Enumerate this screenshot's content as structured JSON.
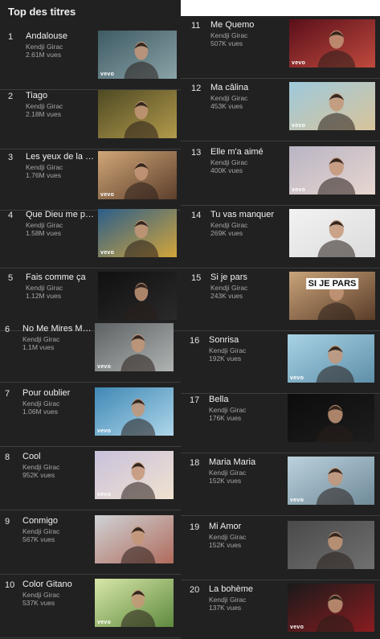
{
  "heading": "Top des titres",
  "tracks": [
    {
      "rank": "1",
      "title": "Andalouse",
      "artist": "Kendji Girac",
      "views": "2.61M vues",
      "badge": "vevo",
      "caption": "",
      "bg": [
        "#3e5a63",
        "#8aa3a8"
      ]
    },
    {
      "rank": "2",
      "title": "Tiago",
      "artist": "Kendji Girac",
      "views": "2.18M vues",
      "badge": "",
      "caption": "",
      "bg": [
        "#4f4a24",
        "#b29a4b"
      ]
    },
    {
      "rank": "3",
      "title": "Les yeux de la ma...",
      "artist": "Kendji Girac",
      "views": "1.76M vues",
      "badge": "vevo",
      "caption": "",
      "bg": [
        "#d1a778",
        "#5c3e2b"
      ]
    },
    {
      "rank": "4",
      "title": "Que Dieu me pardo...",
      "artist": "Kendji Girac",
      "views": "1.58M vues",
      "badge": "vevo",
      "caption": "",
      "bg": [
        "#2b5e8a",
        "#d3a53a"
      ]
    },
    {
      "rank": "5",
      "title": "Fais comme ça",
      "artist": "Kendji Girac",
      "views": "1.12M vues",
      "badge": "",
      "caption": "",
      "bg": [
        "#101010",
        "#2a2a2a"
      ]
    },
    {
      "rank": "6",
      "title": "No Me Mires Más (...",
      "artist": "Kendji Girac",
      "views": "1.1M vues",
      "badge": "vevo",
      "caption": "",
      "bg": [
        "#5d6264",
        "#b0b3b2"
      ]
    },
    {
      "rank": "7",
      "title": "Pour oublier",
      "artist": "Kendji Girac",
      "views": "1.06M vues",
      "badge": "vevo",
      "caption": "",
      "bg": [
        "#3f88b5",
        "#aed6ea"
      ]
    },
    {
      "rank": "8",
      "title": "Cool",
      "artist": "Kendji Girac",
      "views": "952K vues",
      "badge": "vevo",
      "caption": "",
      "bg": [
        "#c9c1dc",
        "#f0e2cf"
      ]
    },
    {
      "rank": "9",
      "title": "Conmigo",
      "artist": "Kendji Girac",
      "views": "567K vues",
      "badge": "",
      "caption": "",
      "bg": [
        "#cfd3d6",
        "#b06b5c"
      ]
    },
    {
      "rank": "10",
      "title": "Color Gitano",
      "artist": "Kendji Girac",
      "views": "537K vues",
      "badge": "vevo",
      "caption": "",
      "bg": [
        "#d8e7a8",
        "#5e8a3e"
      ]
    },
    {
      "rank": "11",
      "title": "Me Quemo",
      "artist": "Kendji Girac",
      "views": "507K vues",
      "badge": "vevo",
      "caption": "",
      "bg": [
        "#5a0f1a",
        "#c04a3e"
      ]
    },
    {
      "rank": "12",
      "title": "Ma câlina",
      "artist": "Kendji Girac",
      "views": "453K vues",
      "badge": "vevo",
      "caption": "",
      "bg": [
        "#9ec9dc",
        "#d8c49a"
      ]
    },
    {
      "rank": "13",
      "title": "Elle m'a aimé",
      "artist": "Kendji Girac",
      "views": "400K vues",
      "badge": "vevo",
      "caption": "",
      "bg": [
        "#b9b4c4",
        "#e7d6cf"
      ]
    },
    {
      "rank": "14",
      "title": "Tu vas manquer",
      "artist": "Kendji Girac",
      "views": "269K vues",
      "badge": "",
      "caption": "",
      "bg": [
        "#f2f2f2",
        "#dcdcdc"
      ]
    },
    {
      "rank": "15",
      "title": "Si je pars",
      "artist": "Kendji Girac",
      "views": "243K vues",
      "badge": "",
      "caption": "SI JE PARS",
      "bg": [
        "#c9a47a",
        "#5a3c28"
      ]
    },
    {
      "rank": "16",
      "title": "Sonrisa",
      "artist": "Kendji Girac",
      "views": "192K vues",
      "badge": "vevo",
      "caption": "",
      "bg": [
        "#a9d3e6",
        "#5e8fa8"
      ]
    },
    {
      "rank": "17",
      "title": "Bella",
      "artist": "Kendji Girac",
      "views": "176K vues",
      "badge": "",
      "caption": "",
      "bg": [
        "#0c0c0c",
        "#1d1d1d"
      ]
    },
    {
      "rank": "18",
      "title": "Maria Maria",
      "artist": "Kendji Girac",
      "views": "152K vues",
      "badge": "vevo",
      "caption": "",
      "bg": [
        "#bcd2de",
        "#6f8a98"
      ]
    },
    {
      "rank": "19",
      "title": "Mi Amor",
      "artist": "Kendji Girac",
      "views": "152K vues",
      "badge": "",
      "caption": "",
      "bg": [
        "#4a4a4a",
        "#707070"
      ]
    },
    {
      "rank": "20",
      "title": "La bohème",
      "artist": "Kendji Girac",
      "views": "137K vues",
      "badge": "vevo",
      "caption": "",
      "bg": [
        "#1a1a1a",
        "#8a1c20"
      ]
    }
  ]
}
